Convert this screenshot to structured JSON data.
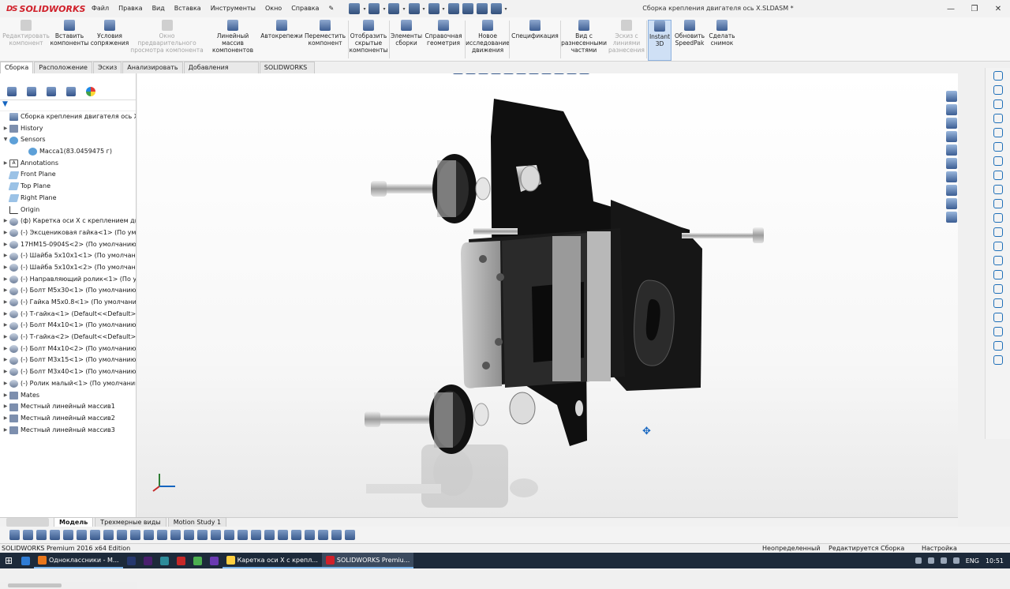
{
  "app": {
    "logo": "SOLIDWORKS",
    "document_title": "Сборка крепления двигателя ось X.SLDASM *"
  },
  "menu": [
    "Файл",
    "Правка",
    "Вид",
    "Вставка",
    "Инструменты",
    "Окно",
    "Справка"
  ],
  "ribbon": [
    {
      "label": "Редактировать компонент",
      "disabled": true
    },
    {
      "label": "Вставить компоненты",
      "disabled": false
    },
    {
      "label": "Условия сопряжения",
      "disabled": false
    },
    {
      "label": "Окно предварительного просмотра компонента",
      "disabled": true
    },
    {
      "label": "Линейный массив компонентов",
      "disabled": false
    },
    {
      "label": "Автокрепежи",
      "disabled": false
    },
    {
      "label": "Переместить компонент",
      "disabled": false
    },
    {
      "label": "Отобразить скрытые компоненты",
      "disabled": false
    },
    {
      "label": "Элементы сборки",
      "disabled": false
    },
    {
      "label": "Справочная геометрия",
      "disabled": false
    },
    {
      "label": "Новое исследование движения",
      "disabled": false
    },
    {
      "label": "Спецификация",
      "disabled": false
    },
    {
      "label": "Вид с разнесенными частями",
      "disabled": false
    },
    {
      "label": "Эскиз с линиями разнесения",
      "disabled": true
    },
    {
      "label": "Instant 3D",
      "disabled": false,
      "active": true
    },
    {
      "label": "Обновить SpeedPak",
      "disabled": false
    },
    {
      "label": "Сделать снимок",
      "disabled": false
    }
  ],
  "tabs": [
    "Сборка",
    "Расположение",
    "Эскиз",
    "Анализировать",
    "Добавления SOLIDWORKS",
    "SOLIDWORKS MBD"
  ],
  "tree": [
    {
      "label": "Сборка крепления двигателя ось X  (Default",
      "type": "asm",
      "level": 0
    },
    {
      "label": "History",
      "type": "fold",
      "level": 1
    },
    {
      "label": "Sensors",
      "type": "sens",
      "level": 1
    },
    {
      "label": "Масса1(83.0459475 г)",
      "type": "sens",
      "level": 2
    },
    {
      "label": "Annotations",
      "type": "ann",
      "level": 1
    },
    {
      "label": "Front Plane",
      "type": "plane",
      "level": 1
    },
    {
      "label": "Top Plane",
      "type": "plane",
      "level": 1
    },
    {
      "label": "Right Plane",
      "type": "plane",
      "level": 1
    },
    {
      "label": "Origin",
      "type": "orig",
      "level": 1
    },
    {
      "label": "(ф) Каретка оси X с креплением двига",
      "type": "part",
      "level": 1
    },
    {
      "label": "(-) Эксцениковая гайка<1> (По умол",
      "type": "part",
      "level": 1
    },
    {
      "label": "17HM15-0904S<2> (По умолчанию<Г",
      "type": "part",
      "level": 1
    },
    {
      "label": "(-) Шайба 5х10х1<1> (По умолчанию<",
      "type": "part",
      "level": 1
    },
    {
      "label": "(-) Шайба 5х10х1<2> (По умолчанию<",
      "type": "part",
      "level": 1
    },
    {
      "label": "(-) Направляющий ролик<1> (По умо",
      "type": "part",
      "level": 1
    },
    {
      "label": "(-) Болт М5х30<1> (По умолчанию<<",
      "type": "part",
      "level": 1
    },
    {
      "label": "(-) Гайка М5х0.8<1> (По умолчанию<",
      "type": "part",
      "level": 1
    },
    {
      "label": "(-) Т-гайка<1> (Default<<Default>_Ph",
      "type": "part",
      "level": 1
    },
    {
      "label": "(-) Болт М4х10<1> (По умолчанию<<",
      "type": "part",
      "level": 1
    },
    {
      "label": "(-) Т-гайка<2> (Default<<Default>_Ph",
      "type": "part",
      "level": 1
    },
    {
      "label": "(-) Болт М4х10<2> (По умолчанию<<",
      "type": "part",
      "level": 1
    },
    {
      "label": "(-) Болт М3х15<1> (По умолчанию<<",
      "type": "part",
      "level": 1
    },
    {
      "label": "(-) Болт М3х40<1> (По умолчанию<<",
      "type": "part",
      "level": 1
    },
    {
      "label": "(-) Ролик малый<1> (По умолчанию-",
      "type": "part",
      "level": 1
    },
    {
      "label": "Mates",
      "type": "fold",
      "level": 1
    },
    {
      "label": "Местный линейный массив1",
      "type": "fold",
      "level": 1
    },
    {
      "label": "Местный линейный массив2",
      "type": "fold",
      "level": 1
    },
    {
      "label": "Местный линейный массив3",
      "type": "fold",
      "level": 1
    }
  ],
  "bottom_tabs": [
    "Модель",
    "Трехмерные виды",
    "Motion Study 1"
  ],
  "status": {
    "edition": "SOLIDWORKS Premium 2016 x64 Edition",
    "state1": "Неопределенный",
    "state2": "Редактируется Сборка",
    "units": "Настройка"
  },
  "taskbar": [
    {
      "label": "Одноклассники - M...",
      "color": "#e8761b"
    },
    {
      "label": "Каретка оси X с крепл...",
      "color": "#ffcf40"
    },
    {
      "label": "SOLIDWORKS Premiu...",
      "color": "#d0202a"
    }
  ],
  "tray": {
    "lang": "ENG",
    "time": "10:51"
  }
}
